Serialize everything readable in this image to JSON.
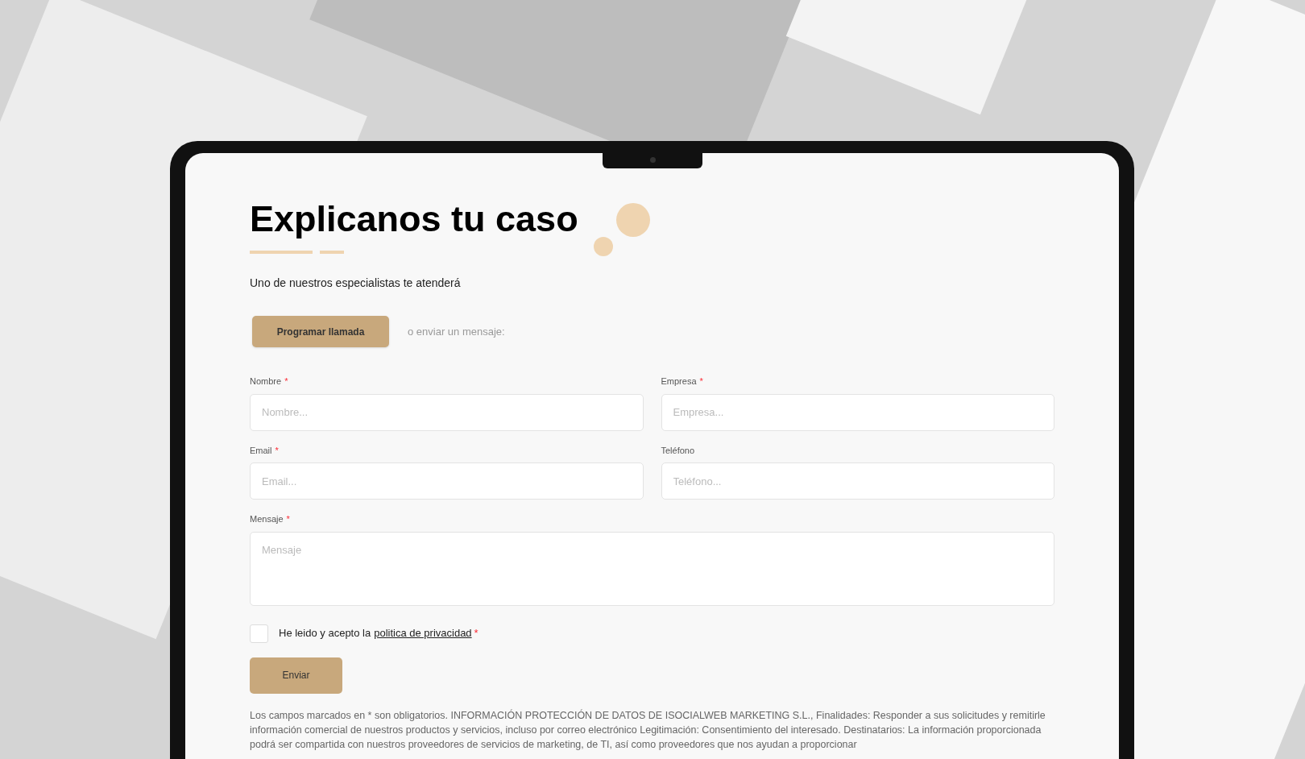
{
  "form": {
    "title": "Explicanos tu caso",
    "subtitle": "Uno de nuestros especialistas te atenderá",
    "call_button": "Programar llamada",
    "alt_text": "o enviar un mensaje:",
    "fields": [
      {
        "label": "Nombre",
        "required_mark": "*",
        "placeholder": "Nombre..."
      },
      {
        "label": "Empresa",
        "required_mark": "*",
        "placeholder": "Empresa..."
      },
      {
        "label": "Email",
        "required_mark": "*",
        "placeholder": "Email..."
      },
      {
        "label": "Teléfono",
        "placeholder": "Teléfono..."
      }
    ],
    "message": {
      "label": "Mensaje",
      "required_mark": "*",
      "placeholder": "Mensaje"
    },
    "consent": {
      "text": "He leido y acepto la",
      "link": "politica de privacidad",
      "required_mark": "*",
      "checked": false
    },
    "submit": "Enviar",
    "disclaimer": "Los campos marcados en * son obligatorios. INFORMACIÓN PROTECCIÓN DE DATOS DE ISOCIALWEB MARKETING S.L., Finalidades: Responder a sus solicitudes y remitirle información comercial de nuestros productos y servicios, incluso por correo electrónico Legitimación: Consentimiento del interesado. Destinatarios: La información proporcionada podrá ser compartida con nuestros proveedores de servicios de marketing, de TI, así como proveedores que nos ayudan a proporcionar"
  }
}
